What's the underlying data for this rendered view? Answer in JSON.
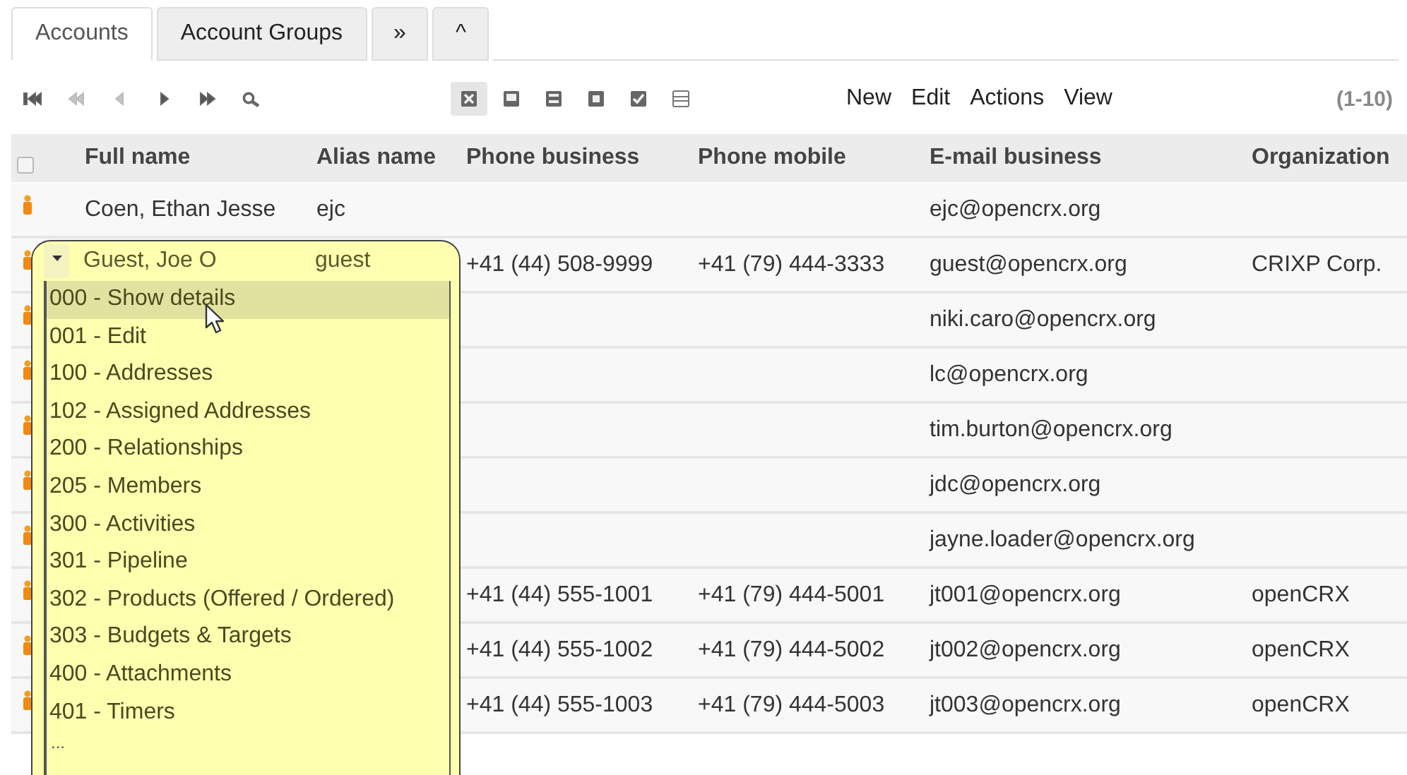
{
  "tabs": [
    {
      "label": "Accounts",
      "selected": true
    },
    {
      "label": "Account Groups",
      "selected": false
    },
    {
      "label": "»",
      "selected": false
    },
    {
      "label": "^",
      "selected": false
    }
  ],
  "toolbar": {
    "nav_buttons": [
      {
        "kind": "first",
        "disabled": false
      },
      {
        "kind": "fast-back",
        "disabled": true
      },
      {
        "kind": "back",
        "disabled": true
      },
      {
        "kind": "forward",
        "disabled": false
      },
      {
        "kind": "fast-forward",
        "disabled": false
      },
      {
        "kind": "search",
        "disabled": false
      }
    ],
    "view_buttons": [
      {
        "kind": "cross",
        "selected": true
      },
      {
        "kind": "bottom",
        "selected": false
      },
      {
        "kind": "middle",
        "selected": false
      },
      {
        "kind": "center",
        "selected": false
      },
      {
        "kind": "check",
        "selected": false
      },
      {
        "kind": "lines",
        "selected": false
      }
    ],
    "menus": [
      "New",
      "Edit",
      "Actions",
      "View"
    ],
    "page_range": "(1-10)"
  },
  "table": {
    "select_all_checked": false,
    "columns": [
      "Full name",
      "Alias name",
      "Phone business",
      "Phone mobile",
      "E-mail business",
      "Organization"
    ],
    "rows": [
      {
        "full_name": "Coen, Ethan Jesse",
        "alias": "ejc",
        "email": "ejc@opencrx.org"
      },
      {
        "phone_business": "+41 (44) 508-9999",
        "phone_mobile": "+41 (79) 444-3333",
        "email": "guest@opencrx.org",
        "organization": "CRIXP Corp."
      },
      {
        "email": "niki.caro@opencrx.org"
      },
      {
        "email": "lc@opencrx.org"
      },
      {
        "email": "tim.burton@opencrx.org"
      },
      {
        "email": "jdc@opencrx.org"
      },
      {
        "email": "jayne.loader@opencrx.org"
      },
      {
        "phone_business": "+41 (44) 555-1001",
        "phone_mobile": "+41 (79) 444-5001",
        "email": "jt001@opencrx.org",
        "organization": "openCRX"
      },
      {
        "phone_business": "+41 (44) 555-1002",
        "phone_mobile": "+41 (79) 444-5002",
        "email": "jt002@opencrx.org",
        "organization": "openCRX"
      },
      {
        "phone_business": "+41 (44) 555-1003",
        "phone_mobile": "+41 (79) 444-5003",
        "email": "jt003@opencrx.org",
        "organization": "openCRX"
      }
    ]
  },
  "popup": {
    "full_name": "Guest, Joe O",
    "alias": "guest",
    "items": [
      {
        "label": "000 - Show details",
        "selected": true
      },
      {
        "label": "001 - Edit",
        "selected": false
      },
      {
        "label": "100 - Addresses",
        "selected": false
      },
      {
        "label": "102 - Assigned Addresses",
        "selected": false
      },
      {
        "label": "200 - Relationships",
        "selected": false
      },
      {
        "label": "205 - Members",
        "selected": false
      },
      {
        "label": "300 - Activities",
        "selected": false
      },
      {
        "label": "301 - Pipeline",
        "selected": false
      },
      {
        "label": "302 - Products (Offered / Ordered)",
        "selected": false
      },
      {
        "label": "303 - Budgets & Targets",
        "selected": false
      },
      {
        "label": "400 - Attachments",
        "selected": false
      },
      {
        "label": "401 - Timers",
        "selected": false
      }
    ],
    "more": "..."
  }
}
